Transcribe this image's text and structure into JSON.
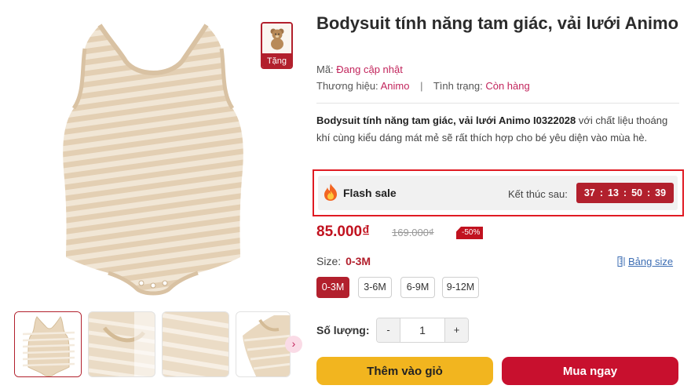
{
  "gallery": {
    "gift_label": "Tặng",
    "next_icon": "chevron-right-icon"
  },
  "product": {
    "title": "Bodysuit tính năng tam giác, vải lưới Animo",
    "code_label": "Mã:",
    "code_value": "Đang cập nhật",
    "brand_label": "Thương hiệu:",
    "brand_value": "Animo",
    "separator": "|",
    "status_label": "Tình trạng:",
    "status_value": "Còn hàng",
    "desc_bold": "Bodysuit tính năng tam giác, vải lưới Animo I0322028",
    "desc_rest": " với chất liệu thoáng khí cùng kiểu dáng mát mẻ sẽ rất thích hợp cho bé yêu diện vào mùa hè."
  },
  "flash_sale": {
    "label": "Flash sale",
    "ends_label": "Kết thúc sau:",
    "countdown": [
      "37",
      "13",
      "50",
      "39"
    ],
    "colon": ":"
  },
  "pricing": {
    "price": "85.000₫",
    "old_price": "169.000₫",
    "discount": "-50%"
  },
  "size": {
    "label": "Size:",
    "selected": "0-3M",
    "guide_label": "Bảng size",
    "options": [
      "0-3M",
      "3-6M",
      "6-9M",
      "9-12M"
    ]
  },
  "quantity": {
    "label": "Số lượng:",
    "minus": "-",
    "plus": "+",
    "value": "1"
  },
  "actions": {
    "add_to_cart": "Thêm vào giỏ",
    "buy_now": "Mua ngay"
  },
  "colors": {
    "brand_red": "#b2202d",
    "price_red": "#c1121f",
    "cart_yellow": "#f2b51f",
    "flash_outline": "#e01b23",
    "link_blue": "#3c6db3"
  }
}
